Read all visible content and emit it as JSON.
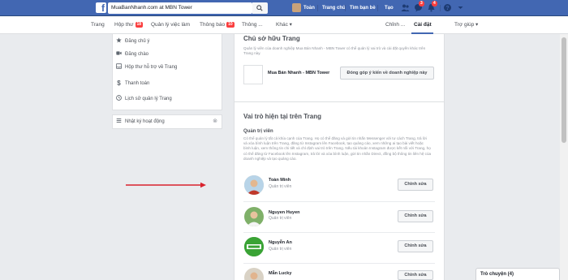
{
  "topbar": {
    "search_value": "MuaBanNhanh.com at MBN Tower",
    "user_name": "Toàn",
    "home": "Trang chủ",
    "find_friends": "Tìm bạn bè",
    "create": "Tạo",
    "messages_badge": "3",
    "notifications_badge": "4"
  },
  "pagenav": {
    "items": [
      "Trang",
      "Hộp thư",
      "Quản lý việc làm",
      "Thông báo",
      "Thông ...",
      "Khác ▾"
    ],
    "inbox_badge": "18",
    "notif_badge": "10",
    "edit": "Chỉnh ...",
    "settings": "Cài đặt",
    "help": "Trợ giúp ▾"
  },
  "sidebar": {
    "items": [
      "Đăng chủ ý",
      "Đăng chào",
      "Hộp thư hỗ trợ về Trang",
      "Thanh toán",
      "Lịch sử quản lý Trang"
    ],
    "activity_log": "Nhật ký hoạt động"
  },
  "owner": {
    "title": "Chủ sở hữu Trang",
    "description": "Quản lý viên của doanh nghiệp Mua Bán Nhanh - MBN Tower có thể quản lý vai trò và cài đặt quyền khác trên Trang này.",
    "name": "Mua Bán Nhanh - MBN Tower",
    "button": "Đóng góp ý kiến về doanh nghiệp này"
  },
  "roles": {
    "title": "Vai trò hiện tại trên Trang",
    "subheading": "Quản trị viên",
    "description": "Có thể quản lý tất cả khía cạnh của Trang. Họ có thể đăng và gửi tin nhắn Messenger với tư cách Trang, trả lời và xóa bình luận trên Trang, đăng từ Instagram lên Facebook, tạo quảng cáo, xem những ai tạo bài viết hoặc bình luận, xem thông tin chi tiết và chỉ định vai trò trên Trang. Nếu tài khoản Instagram được kết nối với Trang, họ có thể đăng từ Facebook lên Instagram, trả lời và xóa bình luận, gửi tin nhắn Direct, đồng bộ thông tin liên hệ của doanh nghiệp và tạo quảng cáo.",
    "people": [
      {
        "name": "Toàn Minh",
        "role": "Quản trị viên",
        "button": "Chỉnh sửa"
      },
      {
        "name": "Nguyen Huyen",
        "role": "Quản trị viên",
        "button": "Chỉnh sửa"
      },
      {
        "name": "Nguyễn An",
        "role": "Quản trị viên",
        "button": "Chỉnh sửa"
      },
      {
        "name": "Mẫn Lucky",
        "role": "",
        "button": "Chỉnh sửa"
      }
    ]
  },
  "chat": {
    "label": "Trò chuyện (4)"
  },
  "colors": {
    "brand": "#4267b2",
    "badge": "#fa3e3e",
    "annotation_arrow": "#d9232d"
  }
}
